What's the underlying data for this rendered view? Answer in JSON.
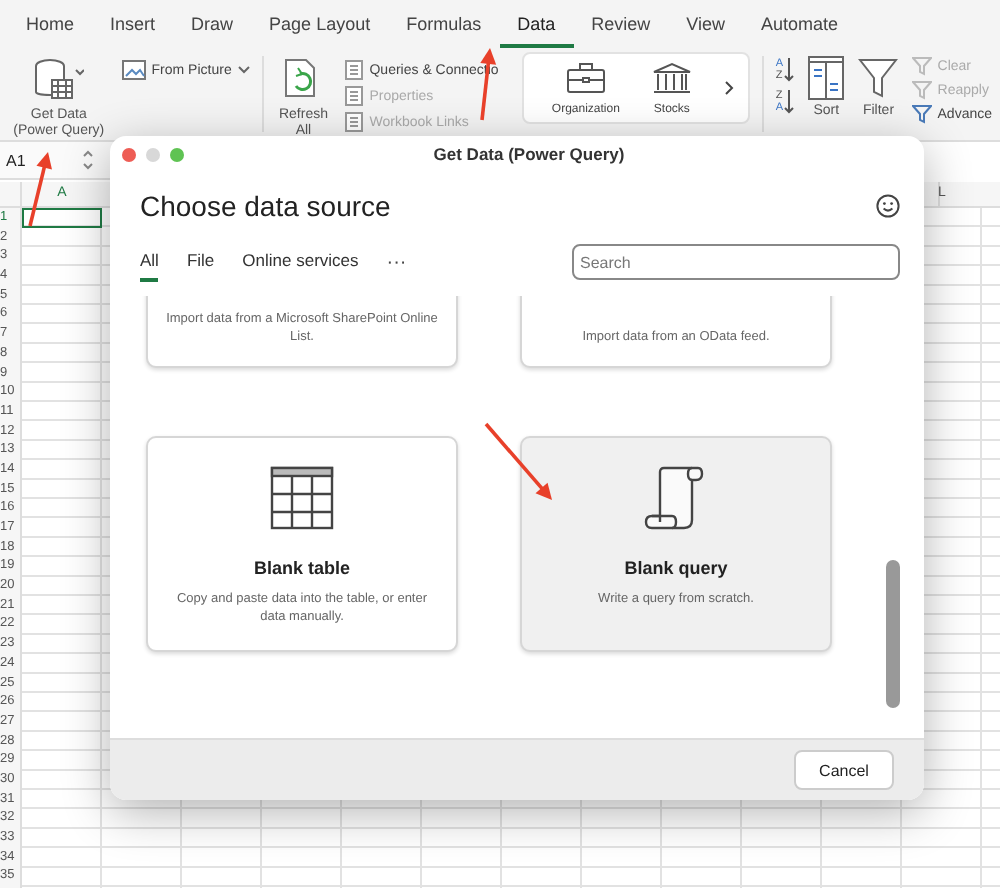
{
  "ribbon": {
    "tabs": [
      {
        "label": "Home",
        "selected": false
      },
      {
        "label": "Insert",
        "selected": false
      },
      {
        "label": "Draw",
        "selected": false
      },
      {
        "label": "Page Layout",
        "selected": false
      },
      {
        "label": "Formulas",
        "selected": false
      },
      {
        "label": "Data",
        "selected": true
      },
      {
        "label": "Review",
        "selected": false
      },
      {
        "label": "View",
        "selected": false
      },
      {
        "label": "Automate",
        "selected": false
      }
    ],
    "get_data": "Get Data (Power Query)",
    "from_picture": "From Picture",
    "refresh_all": "Refresh All",
    "connections": [
      {
        "label": "Queries & Connectio",
        "disabled": false
      },
      {
        "label": "Properties",
        "disabled": true
      },
      {
        "label": "Workbook Links",
        "disabled": true
      }
    ],
    "data_types": [
      "Organization",
      "Stocks"
    ],
    "sort_ascending": [
      "A",
      "Z"
    ],
    "sort_descending": [
      "Z",
      "A"
    ],
    "sort": "Sort",
    "filter": "Filter",
    "filter_actions": [
      {
        "label": "Clear",
        "disabled": true
      },
      {
        "label": "Reapply",
        "disabled": true
      },
      {
        "label": "Advance",
        "disabled": false
      }
    ]
  },
  "sheet": {
    "name_box": "A1",
    "columns": [
      "A",
      "L"
    ],
    "rows": [
      "1",
      "2",
      "3",
      "4",
      "5",
      "6",
      "7",
      "8",
      "9",
      "10",
      "11",
      "12",
      "13",
      "14",
      "15",
      "16",
      "17",
      "18",
      "19",
      "20",
      "21",
      "22",
      "23",
      "24",
      "25",
      "26",
      "27",
      "28",
      "29",
      "30",
      "31",
      "32",
      "33",
      "34",
      "35"
    ]
  },
  "dialog": {
    "title": "Get Data (Power Query)",
    "heading": "Choose data source",
    "tabs": [
      {
        "label": "All",
        "selected": true
      },
      {
        "label": "File",
        "selected": false
      },
      {
        "label": "Online services",
        "selected": false
      }
    ],
    "more": "···",
    "search": {
      "placeholder": "Search"
    },
    "cards": [
      {
        "kind": "clipped",
        "selected": false,
        "description": "Import data from a Microsoft SharePoint Online List."
      },
      {
        "kind": "clipped",
        "selected": false,
        "description": "Import data from an OData feed."
      },
      {
        "kind": "table",
        "selected": false,
        "title": "Blank table",
        "description": "Copy and paste data into the table, or enter data manually."
      },
      {
        "kind": "query",
        "selected": true,
        "title": "Blank query",
        "description": "Write a query from scratch."
      }
    ],
    "buttons": [
      "Cancel"
    ]
  }
}
